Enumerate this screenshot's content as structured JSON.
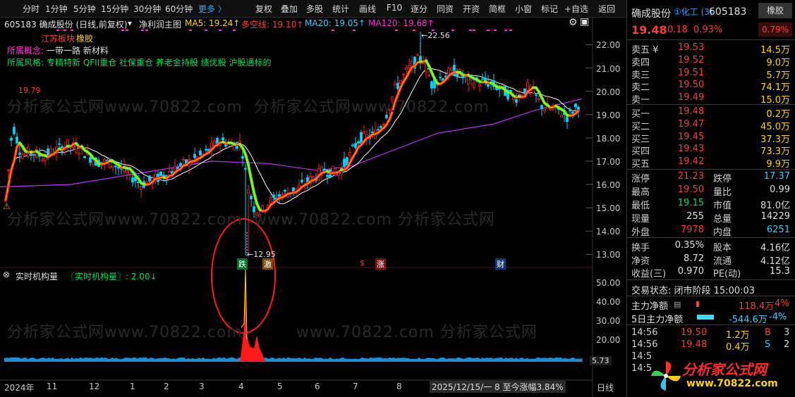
{
  "toolbar": {
    "left": [
      "分时",
      "1分钟",
      "5分钟",
      "15分钟",
      "30分钟",
      "60分钟",
      "更多 〉"
    ],
    "right": [
      "复权",
      "叠加",
      "多股",
      "统计",
      "画线",
      "F10",
      "逐分",
      "同资",
      "开资",
      "简框",
      "小窗",
      "标记",
      "+自选",
      "返回"
    ]
  },
  "chart": {
    "title": "605183 确成股份 (日线,前复权)",
    "indicator": "净利润主图",
    "ma5": "MA5: 19.24↑",
    "multi_short": "多空线: 19.10↑",
    "ma20": "MA20: 19.05↑",
    "ma120": "MA120: 19.68↑",
    "board_label": "江苏板块",
    "board_value": "橡胶",
    "concept_label": "所属概念:",
    "concept_value": "一带一路 新材料",
    "style_label": "所属风格:",
    "style_value": "专精特新 QFII重仓 社保重仓 养老金持股 绩优股 沪股通标的",
    "y_labels": [
      "22.00",
      "21.00",
      "20.00",
      "19.00",
      "18.00",
      "17.00",
      "16.00",
      "15.00",
      "14.00",
      "13.00"
    ],
    "high_mark": "22.56",
    "low_mark": "←12.95",
    "left_mark": "19.79",
    "events": [
      "跌",
      "激",
      "涨",
      "财"
    ],
    "sub_title": "实时机构量",
    "sub_value": "〖实时机构量〗: 2.00↓",
    "sub_y": [
      "50.00",
      "40.00",
      "30.00",
      "20.00"
    ],
    "sub_last": "5.73",
    "x_labels": [
      "2024年",
      "11",
      "12",
      "1",
      "2",
      "3",
      "4",
      "5",
      "6",
      "7",
      "8"
    ],
    "date_info": "2025/12/15/一 8 至今涨幅3.84%",
    "period": "日线",
    "watermark_site": "www.70822.com",
    "watermark_name": "分析家公式网"
  },
  "panel": {
    "name": "确成股份",
    "tag": "①化工 (3)",
    "code": "605183",
    "industry_btn": "橡胶",
    "price": "19.48",
    "change": "0.18",
    "pct": "0.93%",
    "pct2": "0.79%",
    "asks": [
      {
        "label": "卖五 ¥",
        "price": "19.53",
        "vol": "14.5万"
      },
      {
        "label": "卖四",
        "price": "19.52",
        "vol": "9.0万"
      },
      {
        "label": "卖三",
        "price": "19.51",
        "vol": "5.7万"
      },
      {
        "label": "卖二",
        "price": "19.50",
        "vol": "74.1万"
      },
      {
        "label": "卖一",
        "price": "19.49",
        "vol": "15.0万"
      }
    ],
    "bids": [
      {
        "label": "买一",
        "price": "19.48",
        "vol": "0.2万"
      },
      {
        "label": "买二",
        "price": "19.47",
        "vol": "45.0万"
      },
      {
        "label": "买三",
        "price": "19.45",
        "vol": "37.3万"
      },
      {
        "label": "买四",
        "price": "19.43",
        "vol": "73.3万"
      },
      {
        "label": "买五",
        "price": "19.42",
        "vol": "9.9万"
      }
    ],
    "stats": [
      {
        "l1": "涨停",
        "v1": "21.23",
        "l2": "跌停",
        "v2": "17.37"
      },
      {
        "l1": "最高",
        "v1": "19.50",
        "l2": "量比",
        "v2": "0.99"
      },
      {
        "l1": "最低",
        "v1": "19.15",
        "l2": "市值",
        "v2": "81.0亿"
      },
      {
        "l1": "现量",
        "v1": "255",
        "l2": "总量",
        "v2": "14229"
      },
      {
        "l1": "外盘",
        "v1": "7978",
        "l2": "内盘",
        "v2": "6251"
      }
    ],
    "stats2": [
      {
        "l1": "换手",
        "v1": "0.35%",
        "l2": "股本",
        "v2": "4.16亿"
      },
      {
        "l1": "净资",
        "v1": "8.72",
        "l2": "流通",
        "v2": "4.12亿"
      },
      {
        "l1": "收益(三)",
        "v1": "0.970",
        "l2": "PE(动)",
        "v2": "15.3"
      }
    ],
    "trade_status": "交易状态: 闭市阶段 15:00:03",
    "main_net_label": "主力净额",
    "main_net": "118.4万",
    "main_net_pct": "4%",
    "five_net_label": "5日主力净额",
    "five_net": "-544.6万",
    "five_net_pct": "-4%",
    "ticks": [
      {
        "t": "14:56",
        "p": "19.50",
        "v": "1.2万",
        "s": "B",
        "n": "3"
      },
      {
        "t": "14:56",
        "p": "19.48",
        "v": "0.4万",
        "s": "S",
        "n": "2"
      },
      {
        "t": "14:5",
        "p": "",
        "v": "",
        "s": "",
        "n": ""
      },
      {
        "t": "14:5",
        "p": "",
        "v": "",
        "s": "",
        "n": ""
      }
    ],
    "logo_name": "分析家公式网",
    "logo_url": "www.70822.com"
  }
}
